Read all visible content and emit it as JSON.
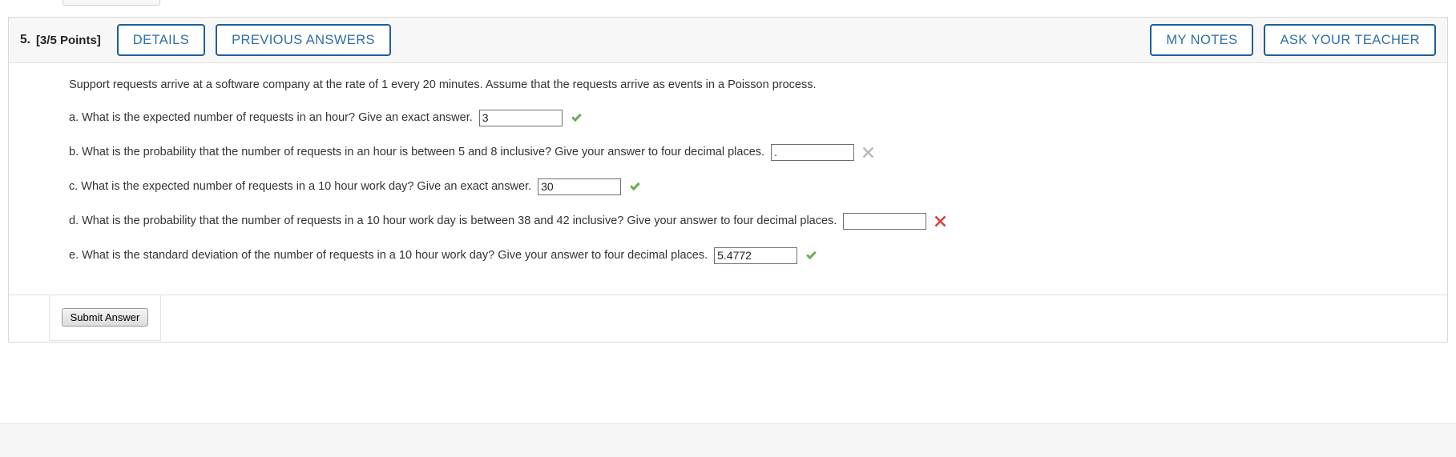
{
  "header": {
    "problem_number": "5.",
    "points": "[3/5 Points]",
    "details_label": "DETAILS",
    "previous_answers_label": "PREVIOUS ANSWERS",
    "my_notes_label": "MY NOTES",
    "ask_your_teacher_label": "ASK YOUR TEACHER",
    "accent_color": "#1f5e96",
    "text_color": "#2f6ea5",
    "background": "#f7f7f7"
  },
  "problem": {
    "intro": "Support requests arrive at a software company at the rate of 1 every 20 minutes. Assume that the requests arrive as events in a Poisson process.",
    "parts": [
      {
        "label": "a. What is the expected number of requests in an hour? Give an exact answer.",
        "value": "3",
        "placeholder": "",
        "status": "correct",
        "status_icon": "green-check-icon",
        "input_width": 108
      },
      {
        "label": "b. What is the probability that the number of requests in an hour is between 5 and 8 inclusive? Give your answer to four decimal places.",
        "value": ".",
        "placeholder": "",
        "status": "ungraded",
        "status_icon": "gray-x-icon",
        "input_width": 108
      },
      {
        "label": "c. What is the expected number of requests in a 10 hour work day? Give an exact answer.",
        "value": "30",
        "placeholder": "",
        "status": "correct",
        "status_icon": "green-check-icon",
        "input_width": 108
      },
      {
        "label": "d. What is the probability that the number of requests in a 10 hour work day is between 38 and 42 inclusive? Give your answer to four decimal places.",
        "value": "",
        "placeholder": "",
        "status": "incorrect",
        "status_icon": "red-x-icon",
        "input_width": 108
      },
      {
        "label": "e. What is the standard deviation of the number of requests in a 10 hour work day? Give your answer to four decimal places.",
        "value": "5.4772",
        "placeholder": "",
        "status": "correct",
        "status_icon": "green-check-icon",
        "input_width": 108
      }
    ]
  },
  "footer": {
    "submit_label": "Submit Answer"
  },
  "colors": {
    "correct_green": "#6cae5c",
    "incorrect_red": "#e03a3a",
    "ungraded_gray": "#b9b9b9",
    "card_border": "#d8d8d8",
    "input_border": "#6f6f6f",
    "body_text": "#333333"
  }
}
